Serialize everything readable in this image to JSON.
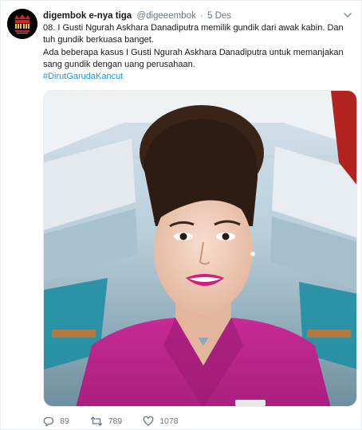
{
  "author": {
    "display_name": "digembok e-nya tiga",
    "handle": "@digeeembok",
    "separator": "·",
    "time": "5 Des"
  },
  "tweet": {
    "line1": "08.  I Gusti Ngurah Askhara Danadiputra memilik gundik dari awak kabin. Dan tuh gundik berkuasa banget.",
    "line2": "Ada beberapa kasus I Gusti Ngurah Askhara Danadiputra untuk memanjakan sang gundik dengan uang perusahaan.",
    "hashtag": "#DirutGarudaKancut"
  },
  "stats": {
    "replies": "89",
    "retweets": "789",
    "likes": "1078"
  },
  "icons": {
    "more": "chevron-down-icon",
    "reply": "reply-icon",
    "retweet": "retweet-icon",
    "like": "heart-icon"
  },
  "colors": {
    "link": "#1b95e0",
    "muted": "#657786",
    "text": "#14171a",
    "uniform": "#c0268e"
  }
}
